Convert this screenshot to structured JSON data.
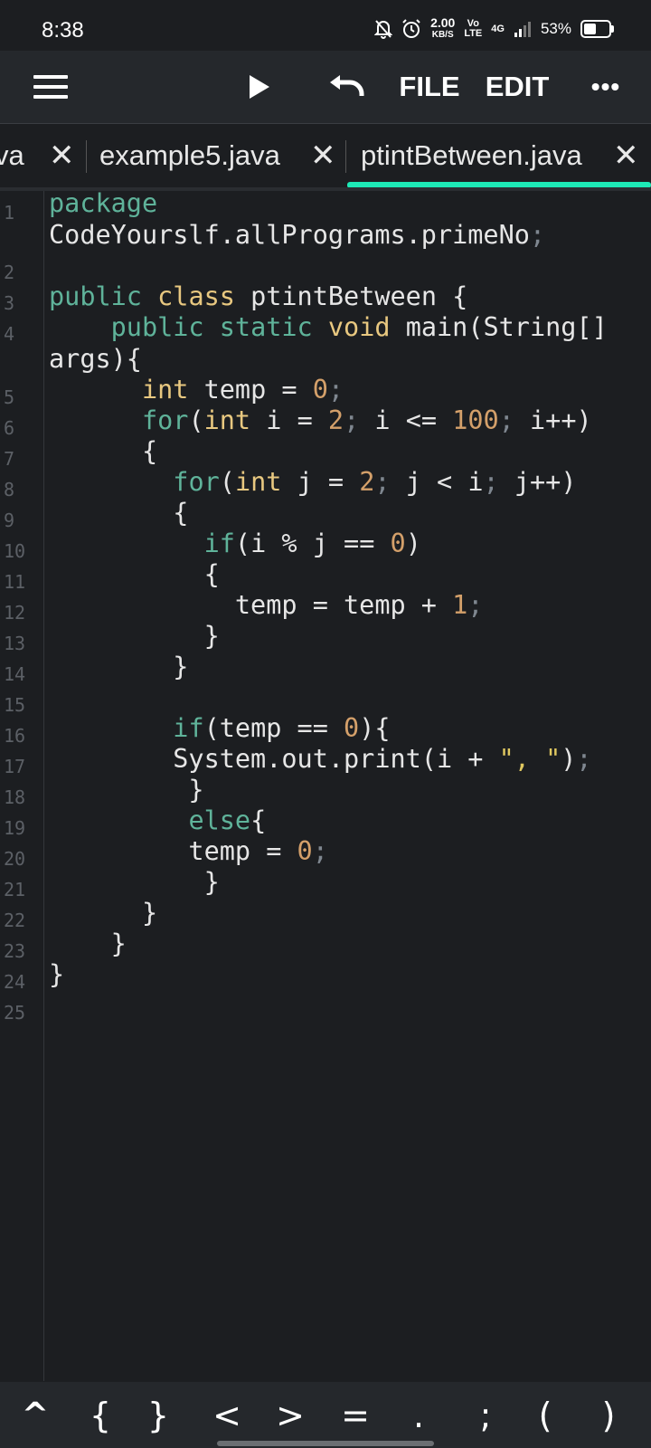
{
  "status_bar": {
    "time": "8:38",
    "net_speed_value": "2.00",
    "net_speed_unit": "KB/S",
    "volte_top": "Vo",
    "volte_bottom": "LTE",
    "network": "4G",
    "battery_percent": "53%",
    "battery_level": 0.53,
    "icons": [
      "mute-bell-icon",
      "alarm-icon",
      "signal-icon",
      "battery-icon"
    ]
  },
  "toolbar": {
    "menu_icon": "hamburger-menu-icon",
    "run_icon": "play-icon",
    "undo_icon": "undo-icon",
    "file_label": "FILE",
    "edit_label": "EDIT",
    "more_label": "•••"
  },
  "tabs": [
    {
      "label": "va",
      "close": "✕",
      "active": false
    },
    {
      "label": "example5.java",
      "close": "✕",
      "active": false
    },
    {
      "label": "ptintBetween.java",
      "close": "✕",
      "active": true
    }
  ],
  "accent_color": "#1de9b6",
  "editor": {
    "line_numbers": [
      "1",
      "2",
      "3",
      "4",
      "5",
      "6",
      "7",
      "8",
      "9",
      "10",
      "11",
      "12",
      "13",
      "14",
      "15",
      "16",
      "17",
      "18",
      "19",
      "20",
      "21",
      "22",
      "23",
      "24",
      "25"
    ],
    "code_lines": [
      "package",
      "CodeYourslf.allPrograms.primeNo;",
      "public class ptintBetween {",
      "    public static void main(String[]",
      "args){",
      "      int temp = 0;",
      "      for(int i = 2; i <= 100; i++)",
      "      {",
      "        for(int j = 2; j < i; j++)",
      "        {",
      "          if(i % j == 0)",
      "          {",
      "            temp = temp + 1;",
      "          }",
      "        }",
      "        if(temp == 0){",
      "        System.out.print(i + \", \");",
      "         }",
      "         else{",
      "         temp = 0;",
      "          }",
      "      }",
      "    }",
      "}"
    ]
  },
  "symbol_bar": [
    "^",
    "{",
    "}",
    "<",
    ">",
    "=",
    ".",
    ";",
    "(",
    ")"
  ]
}
